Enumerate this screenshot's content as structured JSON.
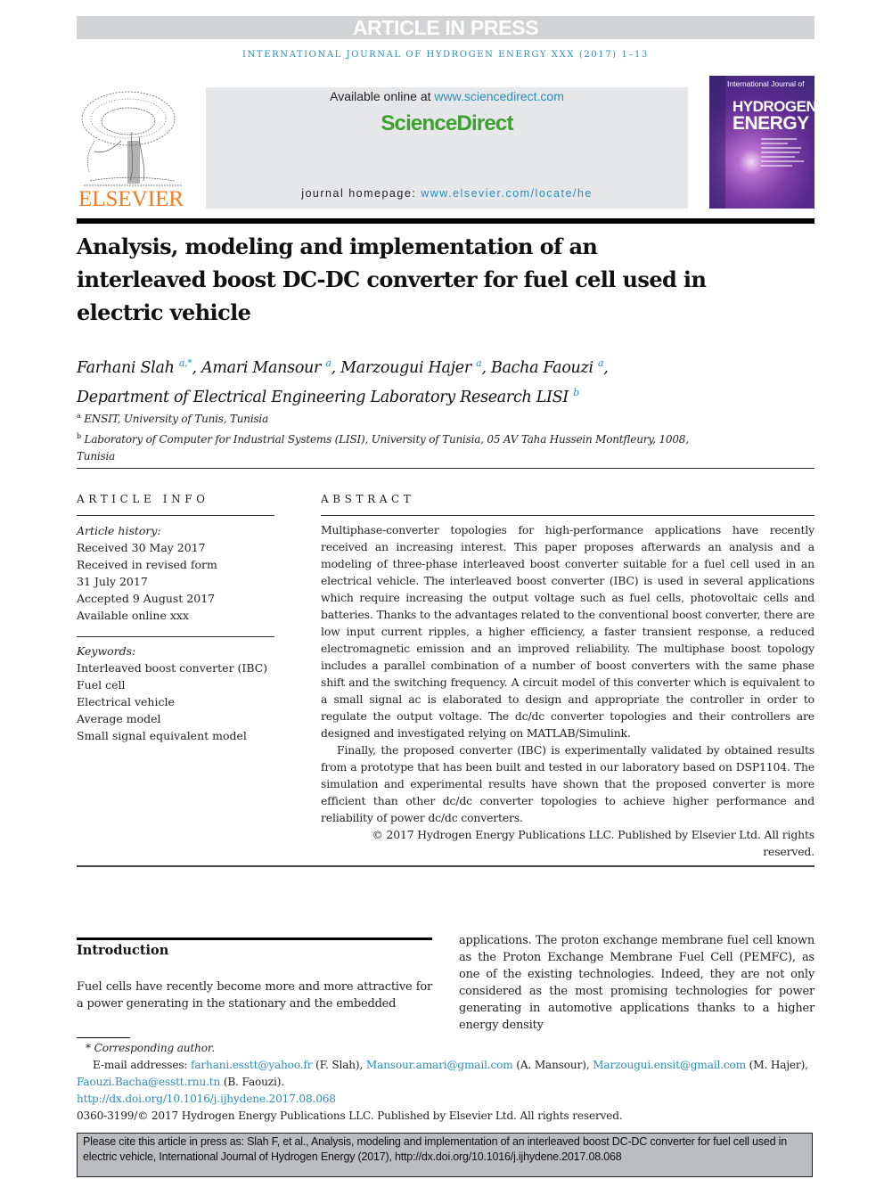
{
  "banner": "ARTICLE IN PRESS",
  "journal_line": "INTERNATIONAL JOURNAL OF HYDROGEN ENERGY XXX (2017) 1–13",
  "publisher": {
    "logo_word": "ELSEVIER",
    "logo_icon": "tree-icon"
  },
  "sciencedirect": {
    "available_prefix": "Available online at ",
    "available_link": "www.sciencedirect.com",
    "logo": "ScienceDirect",
    "homepage_prefix": "journal homepage: ",
    "homepage_link": "www.elsevier.com/locate/he"
  },
  "cover": {
    "top_text": "International Journal of",
    "title_line1": "HYDROGEN",
    "title_line2": "ENERGY"
  },
  "title": "Analysis, modeling and implementation of an interleaved boost DC-DC converter for fuel cell used in electric vehicle",
  "authors": [
    {
      "name": "Farhani Slah",
      "sup": "a,*"
    },
    {
      "name": "Amari Mansour",
      "sup": "a"
    },
    {
      "name": "Marzougui Hajer",
      "sup": "a"
    },
    {
      "name": "Bacha Faouzi",
      "sup": "a"
    },
    {
      "name": "Department of Electrical Engineering Laboratory Research LISI",
      "sup": "b"
    }
  ],
  "affiliations": [
    {
      "sup": "a",
      "text": "ENSIT, University of Tunis, Tunisia"
    },
    {
      "sup": "b",
      "text": "Laboratory of Computer for Industrial Systems (LISI), University of Tunisia, 05 AV Taha Hussein Montfleury, 1008, Tunisia"
    }
  ],
  "article_info": {
    "caption": "ARTICLE INFO",
    "history_label": "Article history:",
    "history": [
      "Received 30 May 2017",
      "Received in revised form",
      "31 July 2017",
      "Accepted 9 August 2017",
      "Available online xxx"
    ],
    "keywords_label": "Keywords:",
    "keywords": [
      "Interleaved boost converter (IBC)",
      "Fuel cell",
      "Electrical vehicle",
      "Average model",
      "Small signal equivalent model"
    ]
  },
  "abstract": {
    "caption": "ABSTRACT",
    "p1": "Multiphase-converter topologies for high-performance applications have recently received an increasing interest. This paper proposes afterwards an analysis and a modeling of three-phase interleaved boost converter suitable for a fuel cell used in an electrical vehicle. The interleaved boost converter (IBC) is used in several applications which require increasing the output voltage such as fuel cells, photovoltaic cells and batteries. Thanks to the advantages related to the conventional boost converter, there are low input current ripples, a higher efficiency, a faster transient response, a reduced electromagnetic emission and an improved reliability. The multiphase boost topology includes a parallel combination of a number of boost converters with the same phase shift and the switching frequency. A circuit model of this converter which is equivalent to a small signal ac is elaborated to design and appropriate the controller in order to regulate the output voltage. The dc/dc converter topologies and their controllers are designed and investigated relying on MATLAB/Simulink.",
    "p2": "Finally, the proposed converter (IBC) is experimentally validated by obtained results from a prototype that has been built and tested in our laboratory based on DSP1104. The simulation and experimental results have shown that the proposed converter is more efficient than other dc/dc converter topologies to achieve higher performance and reliability of power dc/dc converters.",
    "copyright": "© 2017 Hydrogen Energy Publications LLC. Published by Elsevier Ltd. All rights reserved."
  },
  "introduction": {
    "heading": "Introduction",
    "left": "Fuel cells have recently become more and more attractive for a power generating in the stationary and the embedded",
    "right": "applications. The proton exchange membrane fuel cell known as the Proton Exchange Membrane Fuel Cell (PEMFC), as one of the existing technologies. Indeed, they are not only considered as the most promising technologies for power generating in automotive applications thanks to a higher energy density"
  },
  "footnotes": {
    "corresponding": "* Corresponding author.",
    "email_label": "E-mail addresses: ",
    "emails": [
      {
        "email": "farhani.esstt@yahoo.fr",
        "who": " (F. Slah), "
      },
      {
        "email": "Mansour.amari@gmail.com",
        "who": " (A. Mansour), "
      },
      {
        "email": "Marzougui.ensit@gmail.com",
        "who": " (M. Hajer), "
      },
      {
        "email": "Faouzi.Bacha@esstt.rnu.tn",
        "who": " (B. Faouzi)."
      }
    ],
    "doi": "http://dx.doi.org/10.1016/j.ijhydene.2017.08.068",
    "issn_line": "0360-3199/© 2017 Hydrogen Energy Publications LLC. Published by Elsevier Ltd. All rights reserved."
  },
  "citation": "Please cite this article in press as: Slah F, et al., Analysis, modeling and implementation of an interleaved boost DC-DC converter for fuel cell used in electric vehicle, International Journal of Hydrogen Energy (2017), http://dx.doi.org/10.1016/j.ijhydene.2017.08.068",
  "colors": {
    "link": "#2a8dba",
    "elsevier_orange": "#f47a20",
    "sciencedirect_green": "#3aa22d",
    "banner_gray": "#d2d3d5"
  }
}
